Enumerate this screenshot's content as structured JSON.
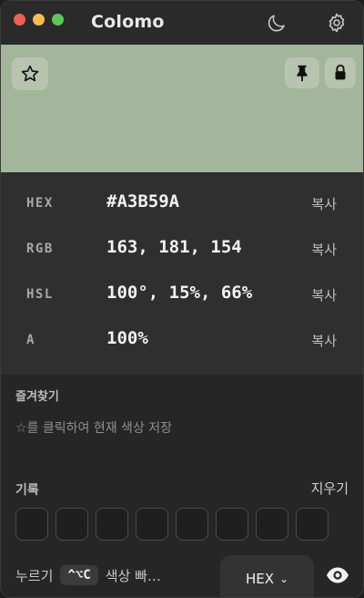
{
  "app": {
    "title": "Colomo"
  },
  "titlebar": {
    "moon_icon": "moon-icon",
    "settings_icon": "gear-icon"
  },
  "swatch": {
    "color": "#A3B59A",
    "star_icon": "star-icon",
    "pin_icon": "pin-icon",
    "lock_icon": "lock-icon"
  },
  "values": [
    {
      "label": "HEX",
      "value": "#A3B59A",
      "copy": "복사"
    },
    {
      "label": "RGB",
      "value": "163, 181, 154",
      "copy": "복사"
    },
    {
      "label": "HSL",
      "value": "100°, 15%, 66%",
      "copy": "복사"
    },
    {
      "label": "A",
      "value": "100%",
      "copy": "복사"
    }
  ],
  "favorites": {
    "title": "즐겨찾기",
    "hint": "☆를 클릭하여 현재 색상 저장"
  },
  "history": {
    "title": "기록",
    "clear": "지우기",
    "slot_count": 8
  },
  "bottom": {
    "press": "누르기",
    "shortcut": "^⌥C",
    "pick_hint": "색상 빠…",
    "format": "HEX",
    "format_chevron": "⌄",
    "eye_icon": "eye-icon"
  }
}
